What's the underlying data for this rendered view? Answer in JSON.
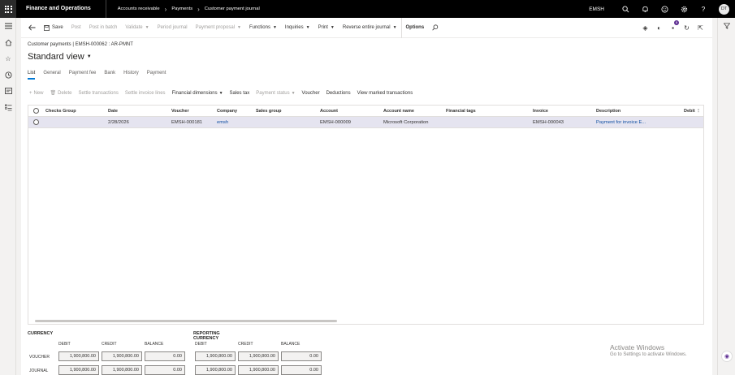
{
  "topbar": {
    "app_title": "Finance and Operations",
    "breadcrumb": [
      "Accounts receivable",
      "Payments",
      "Customer payment journal"
    ],
    "company": "EMSH",
    "avatar_initials": "DT"
  },
  "actionpane": {
    "save": "Save",
    "post": "Post",
    "post_in_batch": "Post in batch",
    "validate": "Validate",
    "period_journal": "Period journal",
    "payment_proposal": "Payment proposal",
    "functions": "Functions",
    "inquiries": "Inquiries",
    "print": "Print",
    "reverse_entire_journal": "Reverse entire journal",
    "options": "Options",
    "notification_count": "8"
  },
  "page": {
    "caption": "Customer payments  |  EMSH-000062 : AR-PMNT",
    "view_name": "Standard view"
  },
  "tabs": [
    "List",
    "General",
    "Payment fee",
    "Bank",
    "History",
    "Payment"
  ],
  "gridtoolbar": {
    "new": "New",
    "delete": "Delete",
    "settle_transactions": "Settle transactions",
    "settle_invoice_lines": "Settle invoice lines",
    "financial_dimensions": "Financial dimensions",
    "sales_tax": "Sales tax",
    "payment_status": "Payment status",
    "voucher": "Voucher",
    "deductions": "Deductions",
    "view_marked_transactions": "View marked transactions"
  },
  "grid": {
    "columns": [
      "Checks Group",
      "Date",
      "Voucher",
      "Company",
      "Sales group",
      "Account",
      "Account name",
      "Financial tags",
      "Invoice",
      "Description",
      "Debit"
    ],
    "rows": [
      {
        "checks_group": "",
        "date": "2/28/2026",
        "voucher": "EMSH-000181",
        "company": "emsh",
        "sales_group": "",
        "account": "EMSH-000009",
        "account_name": "Microsoft Corporation",
        "financial_tags": "",
        "invoice": "EMSH-000043",
        "description": "Payment for invoice E...",
        "debit": ""
      }
    ]
  },
  "totals": {
    "currency_title": "CURRENCY",
    "reporting_title": "REPORTING CURRENCY",
    "col_debit": "DEBIT",
    "col_credit": "CREDIT",
    "col_balance": "BALANCE",
    "row_voucher": "VOUCHER",
    "row_journal": "JOURNAL",
    "currency": {
      "voucher": {
        "debit": "1,900,800.00",
        "credit": "1,900,800.00",
        "balance": "0.00"
      },
      "journal": {
        "debit": "1,900,800.00",
        "credit": "1,900,800.00",
        "balance": "0.00"
      }
    },
    "reporting": {
      "voucher": {
        "debit": "1,900,800.00",
        "credit": "1,900,800.00",
        "balance": "0.00"
      },
      "journal": {
        "debit": "1,900,800.00",
        "credit": "1,900,800.00",
        "balance": "0.00"
      }
    }
  },
  "watermark": {
    "title": "Activate Windows",
    "subtitle": "Go to Settings to activate Windows."
  }
}
